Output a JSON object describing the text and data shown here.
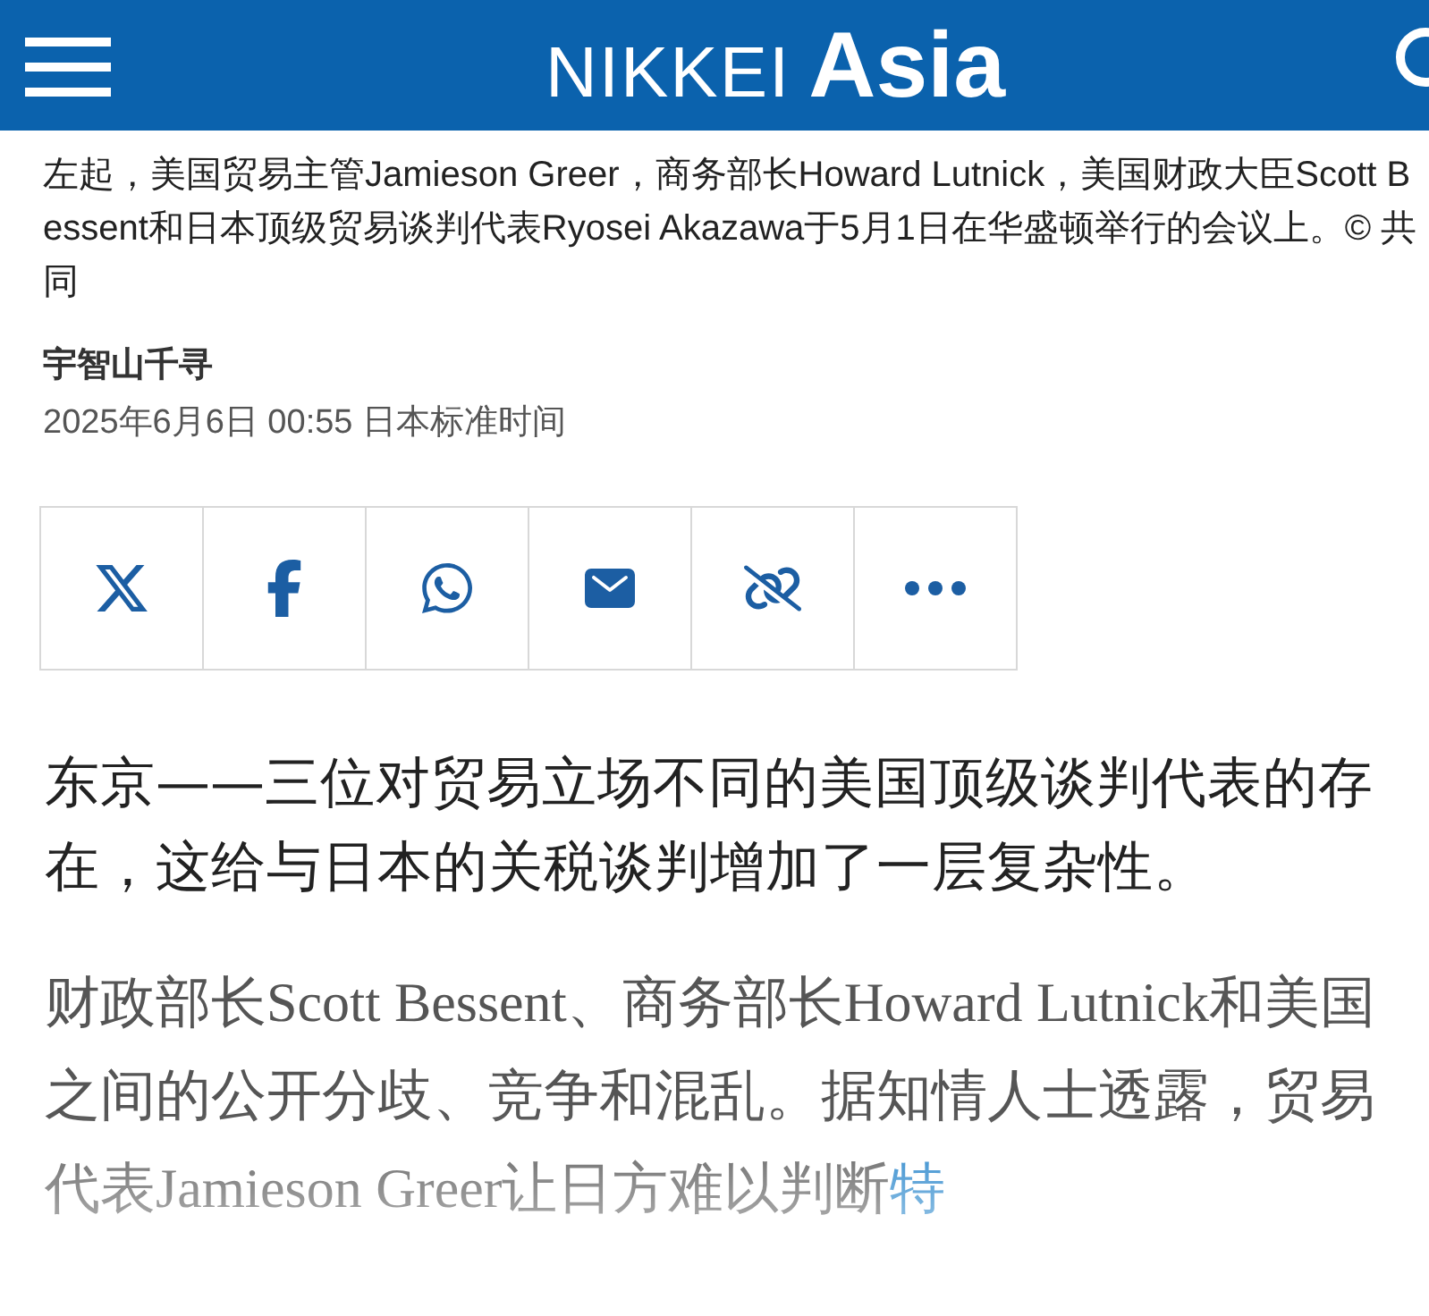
{
  "header": {
    "logo_light": "NIKKEI",
    "logo_bold": "Asia"
  },
  "caption": "左起，美国贸易主管Jamieson Greer，商务部长Howard Lutnick，美国财政大臣Scott Bessent和日本顶级贸易谈判代表Ryosei Akazawa于5月1日在华盛顿举行的会议上。© 共同",
  "author": "宇智山千寻",
  "date": "2025年6月6日 00:55 日本标准时间",
  "share_buttons": [
    {
      "kind": "x"
    },
    {
      "kind": "facebook"
    },
    {
      "kind": "whatsapp"
    },
    {
      "kind": "mail"
    },
    {
      "kind": "link"
    },
    {
      "kind": "more"
    }
  ],
  "lead": "东京——三位对贸易立场不同的美国顶级谈判代表的存在，这给与日本的关税谈判增加了一层复杂性。",
  "body": {
    "text": "财政部长Scott Bessent、商务部长Howard Lutnick和美国之间的公开分歧、竞争和混乱。据知情人士透露，贸易代表Jamieson Greer让日方难以判断",
    "link": "特"
  }
}
